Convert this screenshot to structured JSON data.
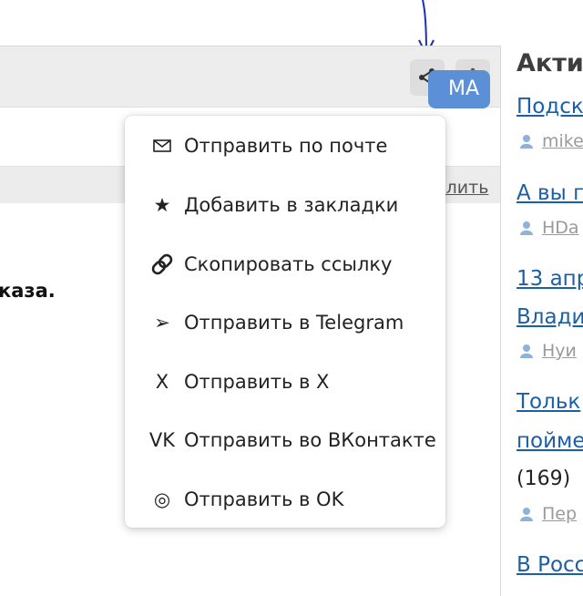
{
  "header": {
    "ma_badge": "MA",
    "strip_link": "алить"
  },
  "content": {
    "text_fragment": "каза."
  },
  "share_menu": {
    "items": [
      {
        "icon": "mail-icon",
        "glyph": "",
        "label": "Отправить по почте"
      },
      {
        "icon": "star-icon",
        "glyph": "★",
        "label": "Добавить в закладки"
      },
      {
        "icon": "link-icon",
        "glyph": "",
        "label": "Скопировать ссылку"
      },
      {
        "icon": "telegram-icon",
        "glyph": "➢",
        "label": "Отправить в Telegram"
      },
      {
        "icon": "x-icon",
        "glyph": "X",
        "label": "Отправить в X"
      },
      {
        "icon": "vk-icon",
        "glyph": "VK",
        "label": "Отправить во ВКонтакте"
      },
      {
        "icon": "ok-icon",
        "glyph": "◎",
        "label": "Отправить в OK"
      }
    ]
  },
  "sidebar": {
    "title": "Акти",
    "entries": [
      {
        "link": "Подск",
        "author": "mike"
      },
      {
        "link": "А вы п",
        "author": "HDa"
      },
      {
        "link_line1": "13 апр",
        "link_line2": "Влади",
        "author": "Нуи"
      },
      {
        "link_line1": "Тольк",
        "link_line2": "пойме",
        "count": "(169)",
        "author": "Пер"
      },
      {
        "link": "В Росс"
      }
    ]
  },
  "colors": {
    "accent": "#5b8fd6",
    "link": "#1a5fa8",
    "annotation_arrow": "#1f2fb5"
  }
}
